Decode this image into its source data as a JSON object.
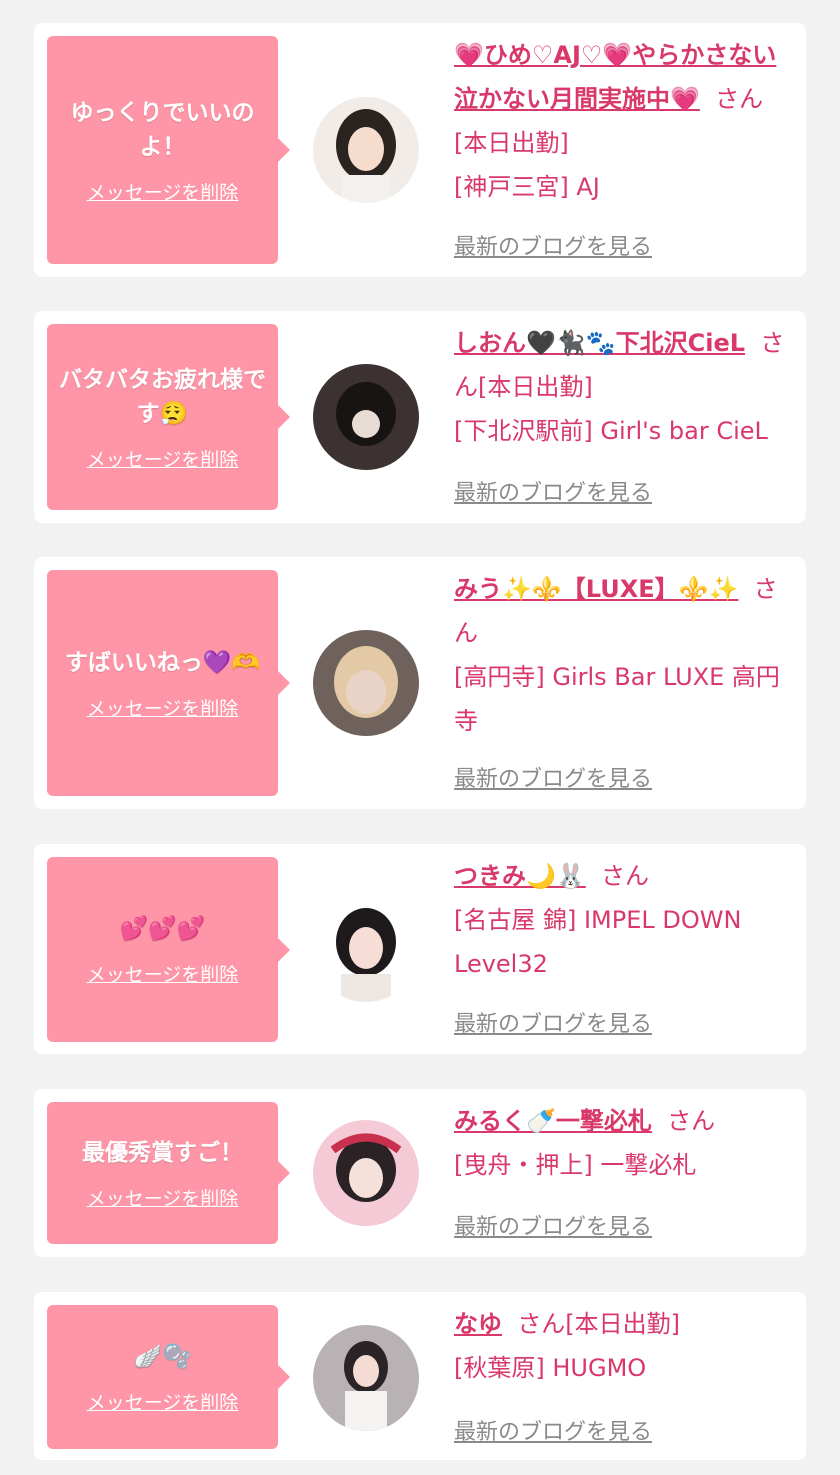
{
  "delete_label": "メッセージを削除",
  "blog_label": "最新のブログを見る",
  "san_label": "さん",
  "cards": [
    {
      "message": "ゆっくりでいいのよ！",
      "name": "💗ひめ♡AJ♡💗やらかさない泣かない月間実施中💗",
      "status": "[本日出勤]",
      "shop": "[神戸三宮] AJ"
    },
    {
      "message": "バタバタお疲れ様です😮‍💨",
      "name": "しおん🖤🐈‍⬛🐾下北沢CieL",
      "status": "[本日出勤]",
      "shop": "[下北沢駅前] Girl's bar CieL"
    },
    {
      "message": "すばいいねっ💜🫶",
      "name": "みう✨⚜️【LUXE】⚜️✨",
      "status": "",
      "shop": "[高円寺] Girls Bar LUXE 高円寺"
    },
    {
      "message": "💕💕💕",
      "name": "つきみ🌙🐰",
      "status": "",
      "shop": "[名古屋 錦] IMPEL DOWN Level32"
    },
    {
      "message": "最優秀賞すご！",
      "name": "みるく🍼一撃必札",
      "status": "",
      "shop": "[曳舟・押上] 一撃必札"
    },
    {
      "message": "🪽🫧",
      "name": "なゆ",
      "status": "[本日出勤]",
      "shop": "[秋葉原] HUGMO"
    }
  ],
  "colors": {
    "bubble": "#ff96a8",
    "accent": "#d9386a",
    "link_gray": "#8a8a8a",
    "background": "#f2f2f2"
  }
}
